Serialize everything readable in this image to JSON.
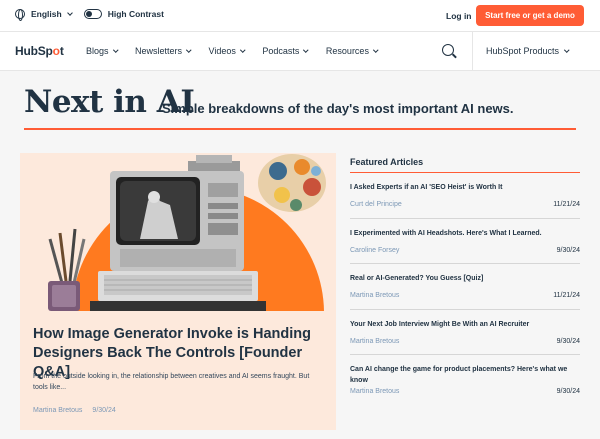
{
  "utility": {
    "language": "English",
    "contrast": "High Contrast",
    "login": "Log in",
    "cta": "Start free or get a demo"
  },
  "nav": {
    "logo": "HubSpot",
    "items": [
      "Blogs",
      "Newsletters",
      "Videos",
      "Podcasts",
      "Resources"
    ],
    "products": "HubSpot Products"
  },
  "header": {
    "title": "Next in AI",
    "subtitle": "Simple breakdowns of the day's most important AI news."
  },
  "hero": {
    "title": "How Image Generator Invoke is Handing Designers Back The Controls [Founder Q&A]",
    "excerpt": "From the outside looking in, the relationship between creatives and AI seems fraught. But tools like...",
    "author": "Martina Bretous",
    "date": "9/30/24"
  },
  "featured": {
    "heading": "Featured Articles",
    "items": [
      {
        "title": "I Asked Experts if an AI 'SEO Heist' is Worth It",
        "author": "Curt del Principe",
        "date": "11/21/24"
      },
      {
        "title": "I Experimented with AI Headshots. Here's What I Learned.",
        "author": "Caroline Forsey",
        "date": "9/30/24"
      },
      {
        "title": "Real or AI-Generated? You Guess [Quiz]",
        "author": "Martina Bretous",
        "date": "11/21/24"
      },
      {
        "title": "Your Next Job Interview Might Be With an AI Recruiter",
        "author": "Martina Bretous",
        "date": "9/30/24"
      },
      {
        "title": "Can AI change the game for product placements? Here's what we know",
        "author": "Martina Bretous",
        "date": "9/30/24"
      }
    ]
  },
  "colors": {
    "accent": "#ff5c35",
    "ink": "#213343",
    "card_bg": "#fde9dc",
    "page_bg": "#f6f6f6"
  }
}
